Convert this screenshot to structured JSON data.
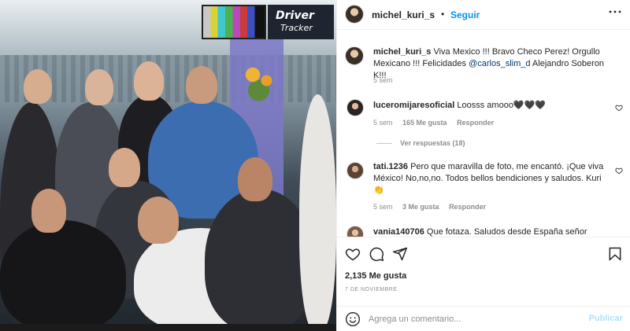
{
  "photo": {
    "screen_title": "Driver",
    "screen_subtitle": "Tracker"
  },
  "header": {
    "username": "michel_kuri_s",
    "separator": "•",
    "follow_label": "Seguir",
    "more_label": "···"
  },
  "caption": {
    "username": "michel_kuri_s",
    "text_before": "Viva Mexico !!! Bravo Checo Perez! Orgullo Mexicano !!! Felicidades ",
    "mention": "@carlos_slim_d",
    "text_after": " Alejandro Soberon K!!!",
    "time": "5 sem"
  },
  "comments": [
    {
      "username": "luceromijaresoficial",
      "text": "Loosss amooo🖤🖤🖤",
      "time": "5 sem",
      "likes": "165 Me gusta",
      "reply": "Responder",
      "view_replies": "Ver respuestas (18)"
    },
    {
      "username": "tati.1236",
      "text": "Pero que maravilla de foto, me encantó. ¡Que viva México! No,no,no. Todos bellos bendiciones y saludos. Kuri 👏",
      "time": "5 sem",
      "likes": "3 Me gusta",
      "reply": "Responder"
    },
    {
      "username": "vania140706",
      "text": "Que fotaza. Saludos desde España señor"
    }
  ],
  "actions": {
    "likes_count": "2,135 Me gusta",
    "date": "7 DE NOVIEMBRE"
  },
  "composer": {
    "placeholder": "Agrega un comentario...",
    "publish_label": "Publicar"
  },
  "colors": {
    "accent": "#0095f6",
    "publish_disabled": "#b2dffc",
    "muted": "#8e8e8e",
    "mention": "#00376b"
  },
  "icons": {
    "like": "heart-icon",
    "comment": "comment-icon",
    "share": "share-icon",
    "save": "bookmark-icon",
    "emoji": "emoji-icon",
    "more": "more-icon"
  }
}
